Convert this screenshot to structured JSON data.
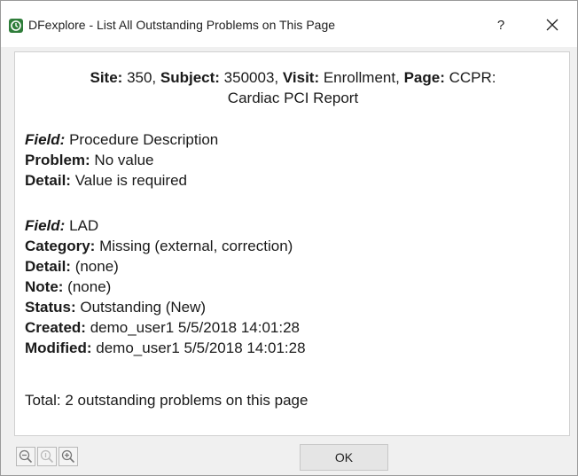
{
  "window": {
    "title": "DFexplore - List All Outstanding Problems on This Page",
    "help_label": "?",
    "accent": "#2f7d3a"
  },
  "header": {
    "site_label": "Site:",
    "site_value": " 350, ",
    "subject_label": "Subject:",
    "subject_value": " 350003, ",
    "visit_label": "Visit:",
    "visit_value": " Enrollment, ",
    "page_label": "Page:",
    "page_value": " CCPR:",
    "page_value_line2": "Cardiac PCI Report"
  },
  "problems": [
    {
      "field_label": "Field:",
      "field_value": " Procedure Description",
      "problem_label": "Problem:",
      "problem_value": " No value",
      "detail_label": "Detail:",
      "detail_value": " Value is required"
    },
    {
      "field_label": "Field:",
      "field_value": " LAD",
      "category_label": "Category:",
      "category_value": " Missing (external, correction)",
      "detail_label": "Detail:",
      "detail_value": " (none)",
      "note_label": "Note:",
      "note_value": " (none)",
      "status_label": "Status:",
      "status_value": " Outstanding (New)",
      "created_label": "Created:",
      "created_value": " demo_user1 5/5/2018 14:01:28",
      "modified_label": "Modified:",
      "modified_value": " demo_user1 5/5/2018 14:01:28"
    }
  ],
  "summary": {
    "total_text": "Total: 2 outstanding problems on this page"
  },
  "footer": {
    "zoom_buttons": [
      "zoom-out-icon",
      "zoom-reset-icon",
      "zoom-in-icon"
    ],
    "ok_label": "OK"
  }
}
